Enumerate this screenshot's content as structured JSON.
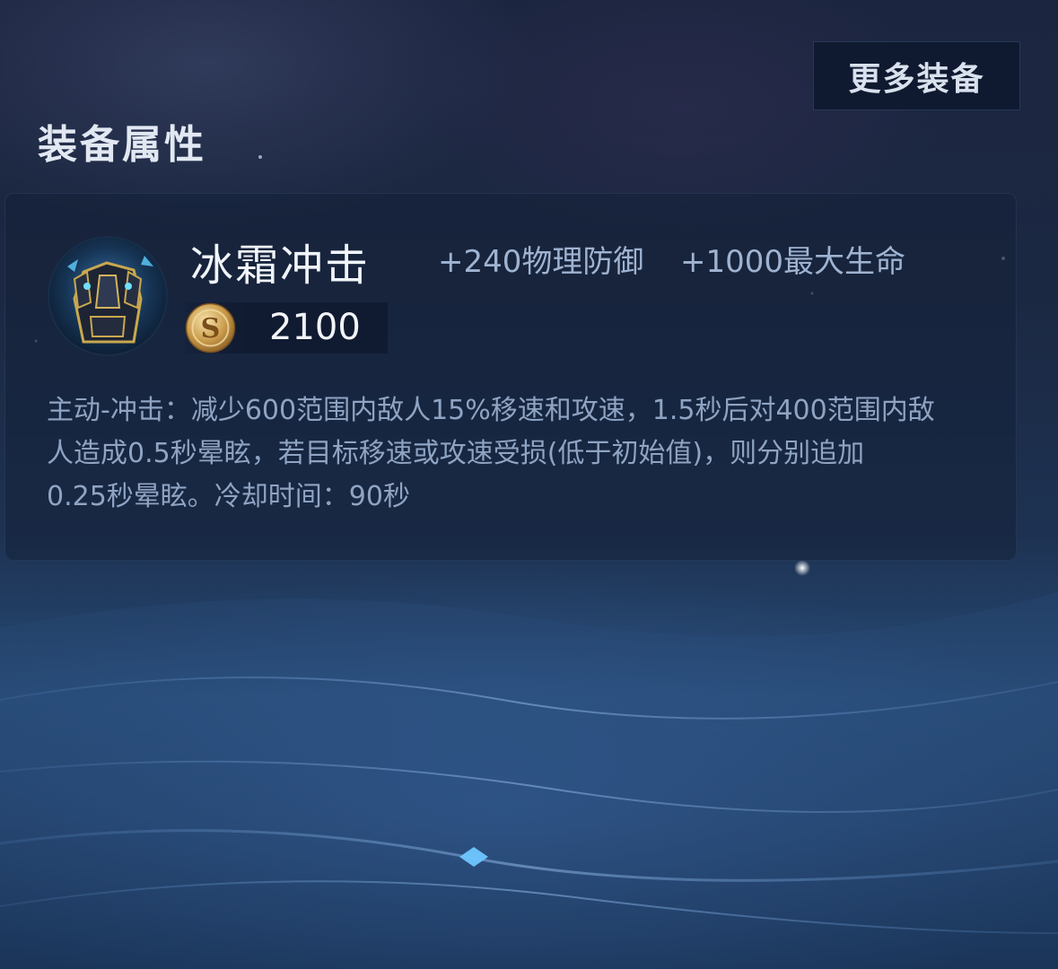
{
  "header": {
    "more_button_label": "更多装备",
    "section_title": "装备属性"
  },
  "item": {
    "name": "冰霜冲击",
    "icon": "armor-icon",
    "stats": [
      "+240物理防御",
      "+1000最大生命"
    ],
    "price_icon": "gold-coin-icon",
    "price": "2100",
    "description_lines": [
      "主动-冲击：减少600范围内敌人15%移速和攻速，1.5秒后对400范围内敌",
      "人造成0.5秒晕眩，若目标移速或攻速受损(低于初始值)，则分别追加",
      "0.25秒晕眩。冷却时间：90秒"
    ]
  },
  "colors": {
    "title_text": "#e2e8f2",
    "stat_text": "#9fb3d1",
    "description_text": "#8fa4c3",
    "button_bg": "#0f1a30"
  }
}
